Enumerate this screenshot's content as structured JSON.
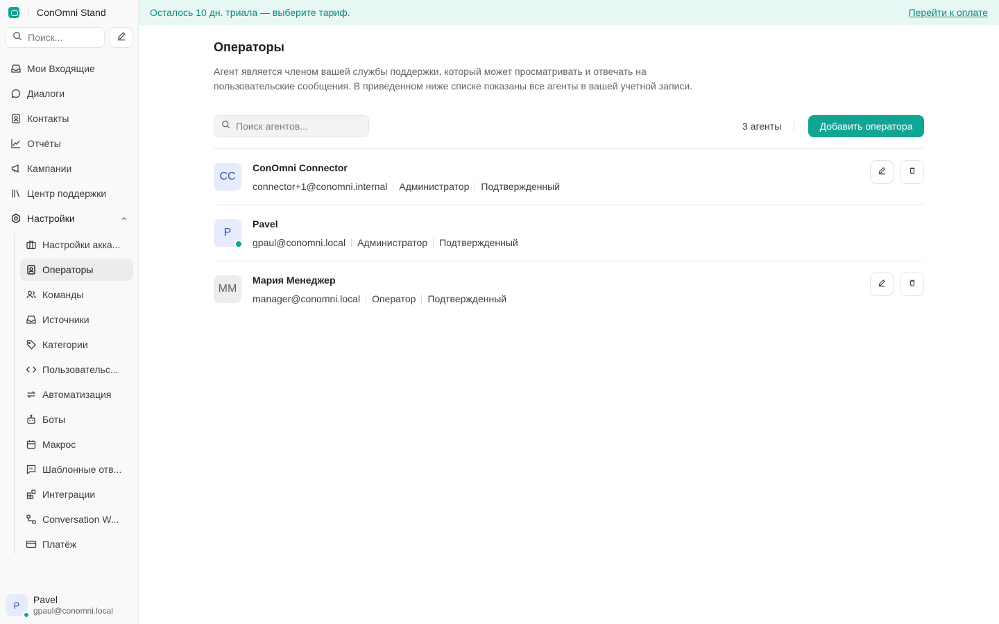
{
  "app": {
    "name": "ConOmni Stand"
  },
  "colors": {
    "accent": "#12a594",
    "banner_bg": "#e6f7f4",
    "active_item_bg": "#ececec",
    "presence_online": "#12a594"
  },
  "banner": {
    "text": "Осталось 10 дн. триала — выберите тариф.",
    "link": "Перейти к оплате"
  },
  "sidebar": {
    "search_placeholder": "Поиск...",
    "items": [
      {
        "label": "Мои Входящие",
        "icon": "inbox-icon"
      },
      {
        "label": "Диалоги",
        "icon": "chat-bubble-icon"
      },
      {
        "label": "Контакты",
        "icon": "contact-card-icon"
      },
      {
        "label": "Отчёты",
        "icon": "line-chart-icon"
      },
      {
        "label": "Кампании",
        "icon": "megaphone-icon"
      },
      {
        "label": "Центр поддержки",
        "icon": "library-icon"
      }
    ],
    "settings": {
      "label": "Настройки",
      "icon": "settings-gear-icon",
      "expanded": true,
      "children": [
        {
          "label": "Настройки акка...",
          "icon": "briefcase-icon",
          "active": false
        },
        {
          "label": "Операторы",
          "icon": "contact-card-icon",
          "active": true
        },
        {
          "label": "Команды",
          "icon": "people-icon",
          "active": false
        },
        {
          "label": "Источники",
          "icon": "inbox-icon",
          "active": false
        },
        {
          "label": "Категории",
          "icon": "tag-icon",
          "active": false
        },
        {
          "label": "Пользовательс...",
          "icon": "code-icon",
          "active": false
        },
        {
          "label": "Автоматизация",
          "icon": "arrows-swap-icon",
          "active": false
        },
        {
          "label": "Боты",
          "icon": "bot-icon",
          "active": false
        },
        {
          "label": "Макрос",
          "icon": "calendar-icon",
          "active": false
        },
        {
          "label": "Шаблонные отв...",
          "icon": "quote-bubble-icon",
          "active": false
        },
        {
          "label": "Интеграции",
          "icon": "grid-plus-icon",
          "active": false
        },
        {
          "label": "Conversation W...",
          "icon": "workflow-icon",
          "active": false
        },
        {
          "label": "Платёж",
          "icon": "credit-card-icon",
          "active": false
        }
      ]
    },
    "profile": {
      "initial": "P",
      "name": "Pavel",
      "email": "gpaul@conomni.local",
      "status": "online"
    }
  },
  "page": {
    "title": "Операторы",
    "description": "Агент является членом вашей службы поддержки, который может просматривать и отвечать на пользовательские сообщения. В приведенном ниже списке показаны все агенты в вашей учетной записи.",
    "search_placeholder": "Поиск агентов...",
    "count_label": "3 агенты",
    "add_button": "Добавить оператора"
  },
  "agents": [
    {
      "initials": "CC",
      "name": "ConOmni Connector",
      "email": "connector+1@conomni.internal",
      "role": "Администратор",
      "status": "Подтвержденный",
      "online": false,
      "avatar_bg": "#e6ecfb",
      "avatar_fg": "#3451b2",
      "actions": true
    },
    {
      "initials": "P",
      "name": "Pavel",
      "email": "gpaul@conomni.local",
      "role": "Администратор",
      "status": "Подтвержденный",
      "online": true,
      "avatar_bg": "#e6ecfb",
      "avatar_fg": "#3451b2",
      "actions": false
    },
    {
      "initials": "ММ",
      "name": "Мария Менеджер",
      "email": "manager@conomni.local",
      "role": "Оператор",
      "status": "Подтвержденный",
      "online": false,
      "avatar_bg": "#ededed",
      "avatar_fg": "#60646c",
      "actions": true
    }
  ]
}
